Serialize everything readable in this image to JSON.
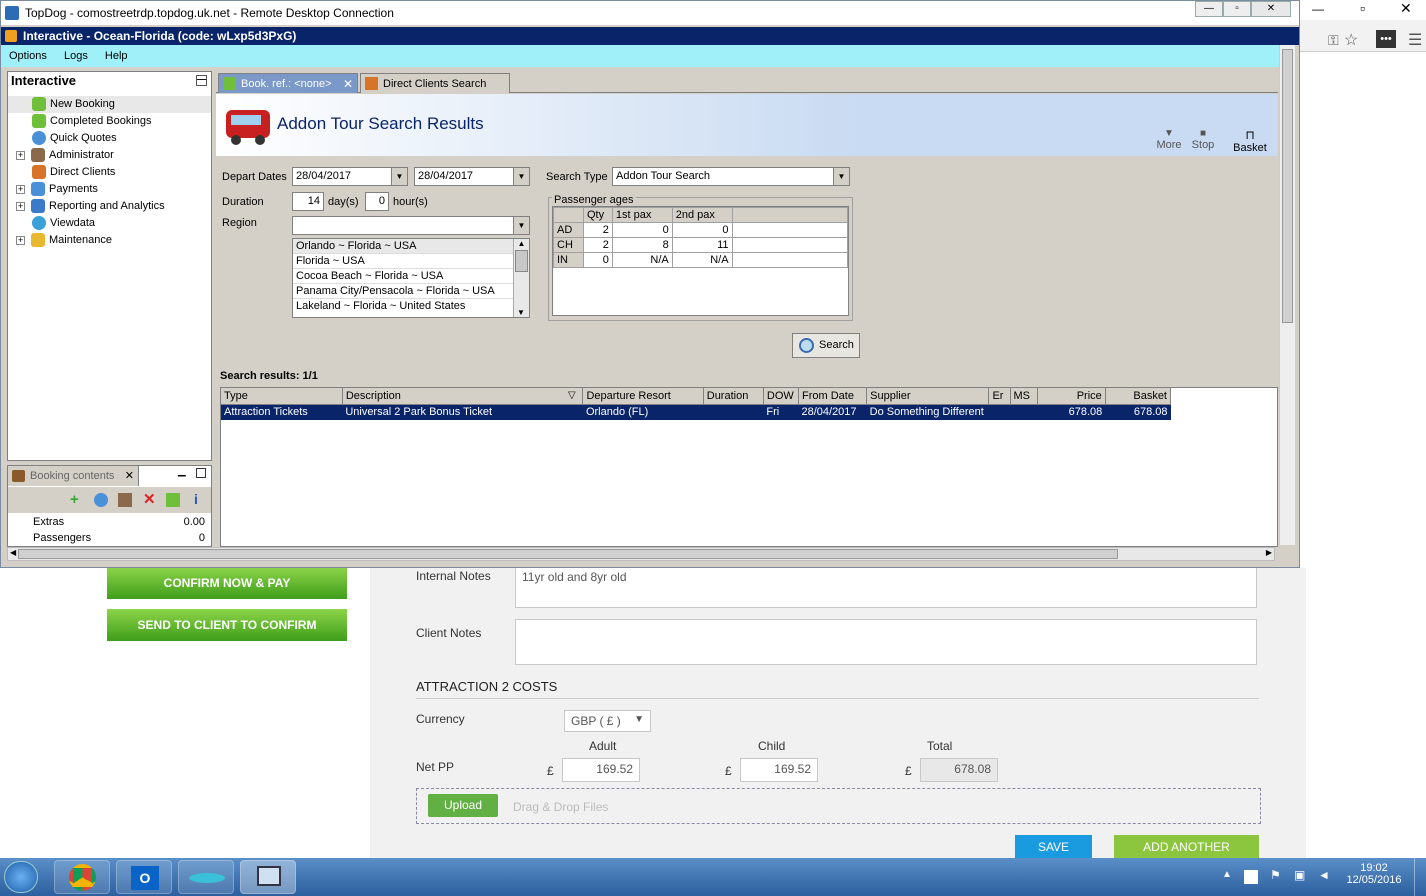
{
  "rdp_window": {
    "title": "TopDog - comostreetrdp.topdog.uk.net - Remote Desktop Connection"
  },
  "app": {
    "title": "Interactive - Ocean-Florida (code: wLxp5d3PxG)",
    "menu": [
      "Options",
      "Logs",
      "Help"
    ]
  },
  "tree": {
    "header": "Interactive",
    "items": [
      "New Booking",
      "Completed Bookings",
      "Quick Quotes",
      "Administrator",
      "Direct Clients",
      "Payments",
      "Reporting and Analytics",
      "Viewdata",
      "Maintenance"
    ]
  },
  "booking_contents": {
    "title": "Booking contents",
    "rows": [
      {
        "label": "Extras",
        "value": "0.00"
      },
      {
        "label": "Passengers",
        "value": "0"
      }
    ]
  },
  "tabs": [
    {
      "label": "Book. ref.: <none>"
    },
    {
      "label": "Direct Clients Search"
    }
  ],
  "page": {
    "title": "Addon Tour Search Results",
    "toolbar": {
      "more": "More",
      "stop": "Stop",
      "basket": "Basket"
    }
  },
  "form": {
    "depart_dates_label": "Depart Dates",
    "depart_from": "28/04/2017",
    "depart_to": "28/04/2017",
    "duration_label": "Duration",
    "duration_days": "14",
    "days_unit": "day(s)",
    "duration_hours": "0",
    "hours_unit": "hour(s)",
    "region_label": "Region",
    "region_value": "",
    "region_options": [
      "Orlando ~ Florida ~ USA",
      "Florida ~ USA",
      "Cocoa Beach ~ Florida ~ USA",
      "Panama City/Pensacola ~  Florida  ~ USA",
      "Lakeland ~ Florida ~ United States"
    ],
    "search_type_label": "Search Type",
    "search_type_value": "Addon Tour Search",
    "passenger_ages_label": "Passenger ages",
    "pax_headers": [
      "",
      "Qty",
      "1st pax",
      "2nd pax"
    ],
    "pax_rows": [
      [
        "AD",
        "2",
        "0",
        "0"
      ],
      [
        "CH",
        "2",
        "8",
        "11"
      ],
      [
        "IN",
        "0",
        "N/A",
        "N/A"
      ]
    ],
    "search_button": "Search"
  },
  "results": {
    "label": "Search results: 1/1",
    "columns": [
      "Type",
      "Description",
      "Departure Resort",
      "Duration",
      "DOW",
      "From Date",
      "Supplier",
      "Er",
      "MS",
      "Price",
      "Basket"
    ],
    "rows": [
      [
        "Attraction Tickets",
        "Universal 2 Park Bonus Ticket",
        "Orlando (FL)",
        "",
        "Fri",
        "28/04/2017",
        "Do Something Different",
        "",
        "",
        "678.08",
        "678.08"
      ]
    ]
  },
  "web": {
    "confirm_pay": "CONFIRM NOW & PAY",
    "send_client": "SEND TO CLIENT TO CONFIRM",
    "internal_notes_label": "Internal Notes",
    "internal_notes_value": "11yr old and 8yr old",
    "client_notes_label": "Client Notes",
    "section_title": "ATTRACTION 2 COSTS",
    "currency_label": "Currency",
    "currency_value": "GBP ( £ )",
    "adult_label": "Adult",
    "child_label": "Child",
    "total_label": "Total",
    "net_pp_label": "Net PP",
    "currency_symbol": "£",
    "adult_value": "169.52",
    "child_value": "169.52",
    "total_value": "678.08",
    "upload": "Upload",
    "drag_drop": "Drag & Drop Files",
    "save": "SAVE",
    "add_another": "ADD ANOTHER"
  },
  "taskbar": {
    "time": "19:02",
    "date": "12/05/2016"
  },
  "colors": {
    "accent_navy": "#0a246a",
    "menubar": "#9ff0f8",
    "green_button": "#3f9e1a",
    "save_blue": "#1a9be0",
    "add_green": "#8cc63f"
  }
}
